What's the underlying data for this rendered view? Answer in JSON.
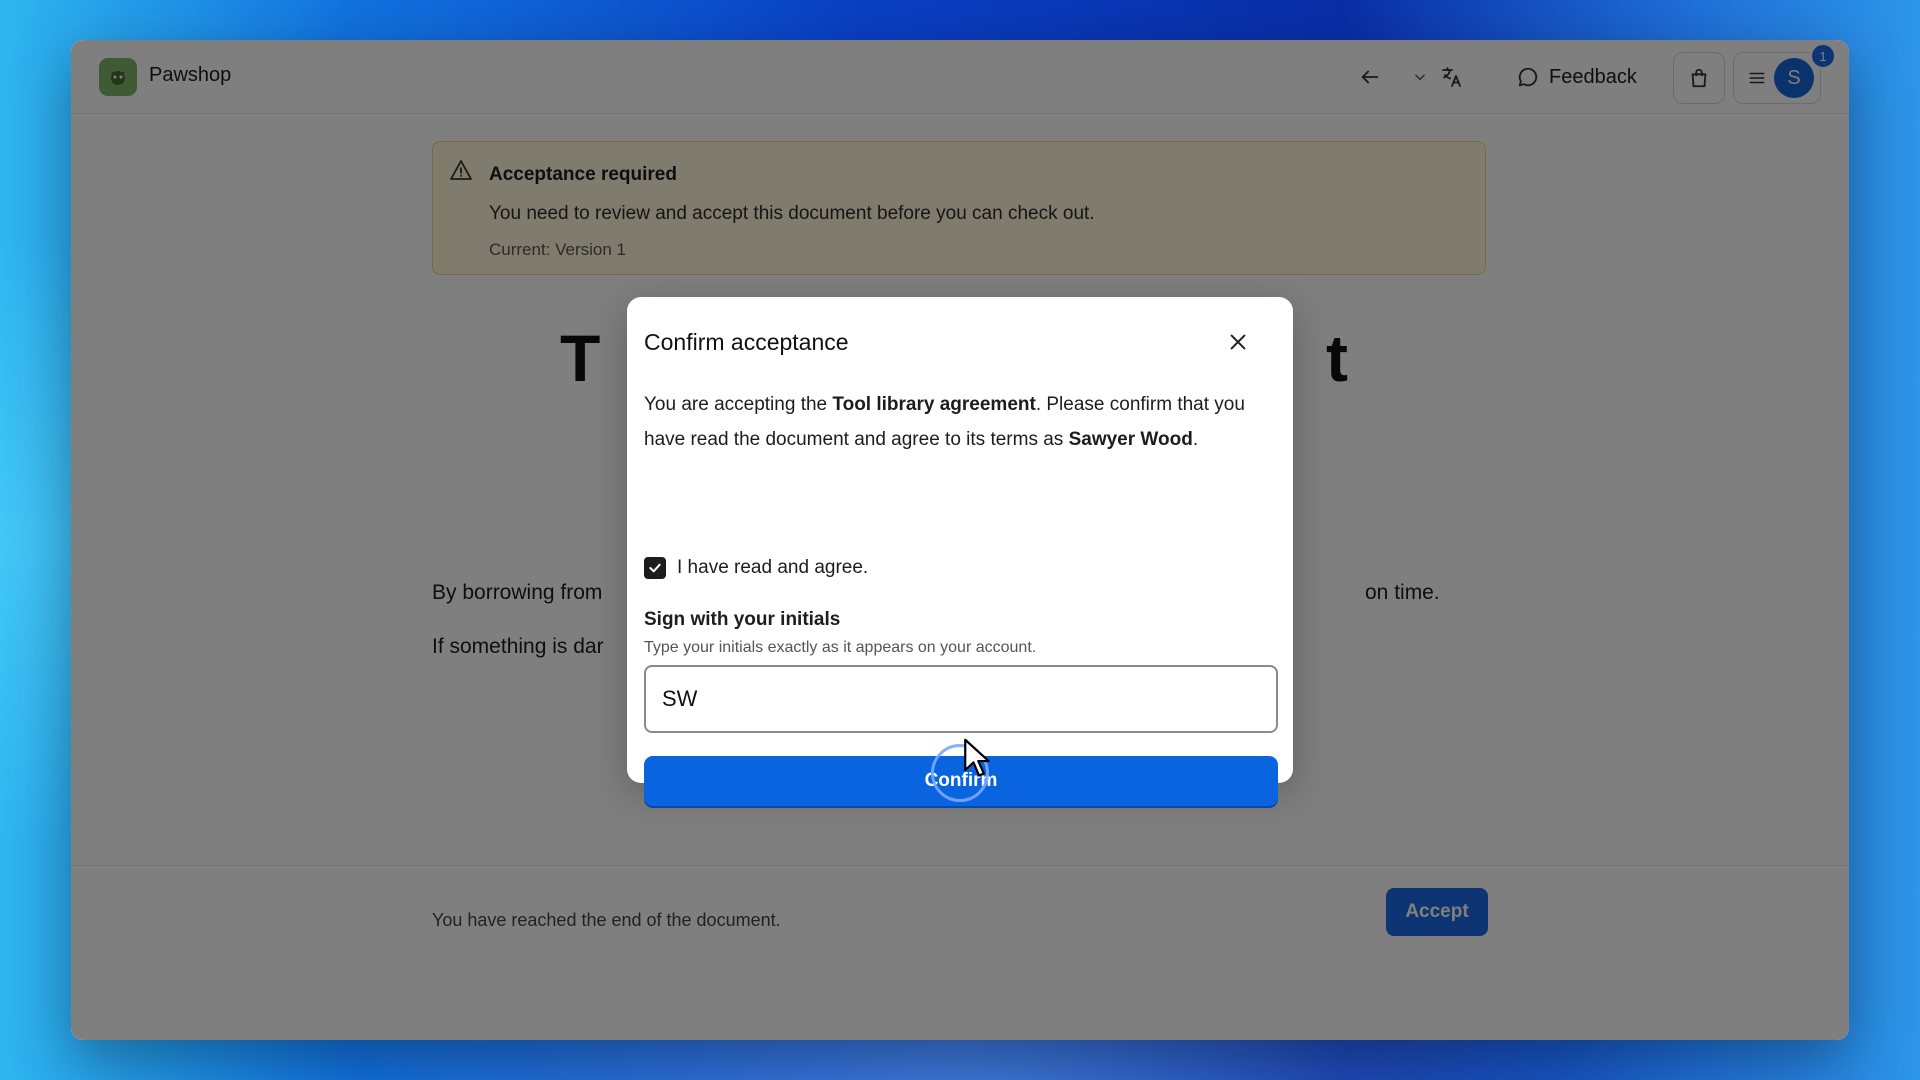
{
  "header": {
    "app_name": "Pawshop",
    "feedback_label": "Feedback",
    "avatar_initial": "S",
    "notification_count": "1",
    "icons": [
      "back-arrow-icon",
      "chevron-down-icon",
      "translate-icon",
      "feedback-icon",
      "shopping-bag-icon",
      "menu-icon"
    ]
  },
  "alert": {
    "title": "Acceptance required",
    "body": "You need to review and accept this document before you can check out.",
    "version": "Current: Version 1"
  },
  "document": {
    "title_left": "T",
    "title_right": "t",
    "paragraph1_left": "By borrowing from",
    "paragraph1_right": "on time.",
    "paragraph2_left": "If something is dar"
  },
  "footer": {
    "end_text": "You have reached the end of the document.",
    "accept_label": "Accept"
  },
  "modal": {
    "title": "Confirm acceptance",
    "desc_prefix": "You are accepting the ",
    "document_name": "Tool library agreement",
    "desc_middle": ". Please confirm that you have read the document and agree to its terms as ",
    "user_name": "Sawyer Wood",
    "desc_suffix": ".",
    "checkbox_label": "I have read and agree.",
    "checkbox_checked": true,
    "field_label": "Sign with your initials",
    "field_hint": "Type your initials exactly as it appears on your account.",
    "initials_value": "SW",
    "confirm_label": "Confirm"
  },
  "colors": {
    "accent": "#0a64e0",
    "alert_bg": "#fff8dd",
    "alert_border": "#f2d479"
  }
}
